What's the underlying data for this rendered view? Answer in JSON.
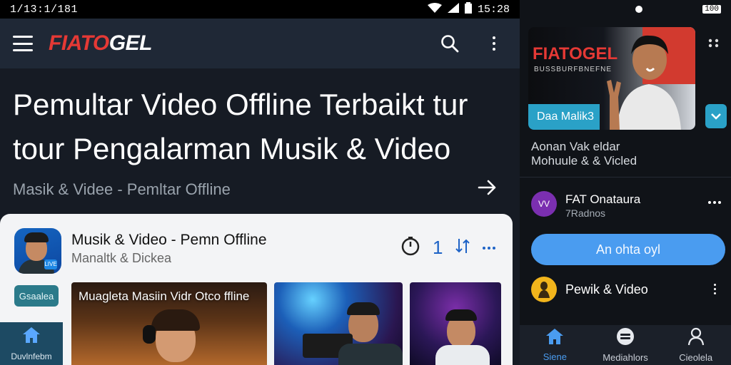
{
  "status_left": {
    "time": "1/13:1/181",
    "clock": "15:28"
  },
  "header": {
    "logo_part1": "FIAT",
    "logo_part2": "O",
    "logo_part3": "GEL"
  },
  "headline": {
    "line1": "Pemultar Video Offline Terbaikt tur",
    "line2": "tour Pengalarman Musik & Video",
    "subtitle": "Masik & Videe - Pemltar Offline"
  },
  "card": {
    "title": "Musik & Video - Pemn Offline",
    "subtitle": "Manaltk & Dickea",
    "count": "1",
    "chip": "Gsaalea",
    "thumb1_caption": "Muagleta Masiin Vidr Otco ffline",
    "avatar_badge": "LIVE"
  },
  "bottom_nav_left": {
    "label": "Duvlnfebm"
  },
  "right_status": {
    "battery": "100"
  },
  "hero": {
    "logo": "FIATOGEL",
    "subtext": "BUSSBURFBNEFNE",
    "bar_label": "Daa Malik3"
  },
  "video_info": {
    "line1": "Aonan Vak eldar",
    "line2": "Mohuule & & Vicled"
  },
  "channel": {
    "name": "FAT Onataura",
    "meta": "7Radnos",
    "avatar_text": "VV"
  },
  "action_button": {
    "label": "An ohta oyl"
  },
  "list_item": {
    "label": "Pewik & Video"
  },
  "right_nav": {
    "items": [
      {
        "label": "Siene"
      },
      {
        "label": "Mediahlors"
      },
      {
        "label": "Cieolela"
      }
    ]
  },
  "colors": {
    "accent_blue": "#4a9cf0",
    "teal": "#2aa1c7",
    "brand_red": "#e53935"
  }
}
